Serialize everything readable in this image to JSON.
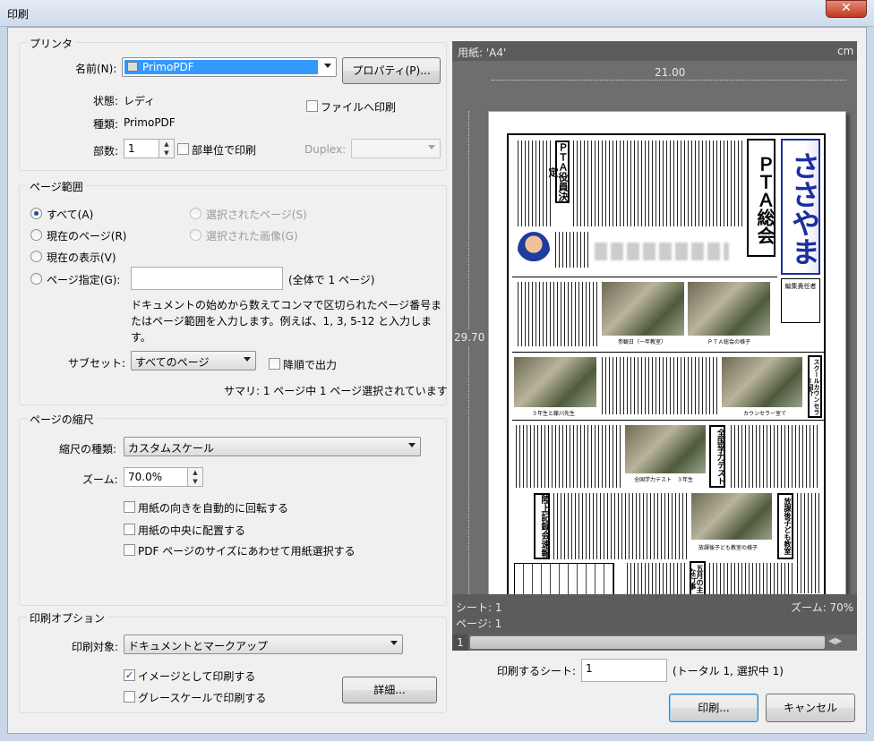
{
  "window": {
    "title": "印刷",
    "close_glyph": "✕"
  },
  "printer": {
    "group_label": "プリンタ",
    "name_label": "名前(N):",
    "name_value": "PrimoPDF",
    "properties_button": "プロパティ(P)...",
    "status_label": "状態:",
    "status_value": "レディ",
    "type_label": "種類:",
    "type_value": "PrimoPDF",
    "print_to_file": "ファイルへ印刷",
    "copies_label": "部数:",
    "copies_value": "1",
    "collate": "部単位で印刷",
    "duplex_label": "Duplex:"
  },
  "range": {
    "group_label": "ページ範囲",
    "all": "すべて(A)",
    "current_page": "現在のページ(R)",
    "current_view": "現在の表示(V)",
    "page_spec": "ページ指定(G):",
    "selected_pages": "選択されたページ(S)",
    "selected_images": "選択された画像(G)",
    "total_pages": "(全体で 1 ページ)",
    "help_line1": "ドキュメントの始めから数えてコンマで区切られたページ番号ま",
    "help_line2": "たはページ範囲を入力します。例えば、1, 3, 5-12 と入力しま",
    "help_line3": "す。",
    "subset_label": "サブセット:",
    "subset_value": "すべてのページ",
    "reverse": "降順で出力",
    "summary": "サマリ: 1 ページ中 1 ページ選択されています"
  },
  "scaling": {
    "group_label": "ページの縮尺",
    "type_label": "縮尺の種類:",
    "type_value": "カスタムスケール",
    "zoom_label": "ズーム:",
    "zoom_value": "70.0%",
    "auto_rotate": "用紙の向きを自動的に回転する",
    "center": "用紙の中央に配置する",
    "pdf_size": "PDF ページのサイズにあわせて用紙選択する"
  },
  "options": {
    "group_label": "印刷オプション",
    "target_label": "印刷対象:",
    "target_value": "ドキュメントとマークアップ",
    "as_image": "イメージとして印刷する",
    "as_image_checked": true,
    "grayscale": "グレースケールで印刷する",
    "details_button": "詳細..."
  },
  "preview": {
    "paper_label": "用紙: 'A4'",
    "unit": "cm",
    "width": "21.00",
    "height": "29.70",
    "sheet": "シート: 1",
    "page": "ページ: 1",
    "zoom": "ズーム: 70%",
    "tab": "1",
    "newspaper": {
      "title": "ささやま",
      "headline1": "ＰＴＡ総会",
      "headline2": "ＰＴＡ役員決定",
      "headline3": "スクールカウンセラー紹介",
      "headline4": "全国学力テスト",
      "headline5": "放課後子ども教室",
      "headline6": "陸上記録会速報",
      "headline7": "五月の主な行事",
      "cap1": "参観日（一年教室）",
      "cap2": "ＰＴＡ総会の様子",
      "cap3": "３年生と藤川先生",
      "cap4": "カウンセラー室で",
      "cap5": "全国学力テスト　３年生",
      "cap6": "放課後子ども教室の様子",
      "editor": "編集責任者"
    }
  },
  "bottom": {
    "sheets_label": "印刷するシート:",
    "sheets_value": "1",
    "sheets_total": "(トータル 1, 選択中 1)",
    "print_button": "印刷...",
    "cancel_button": "キャンセル"
  }
}
